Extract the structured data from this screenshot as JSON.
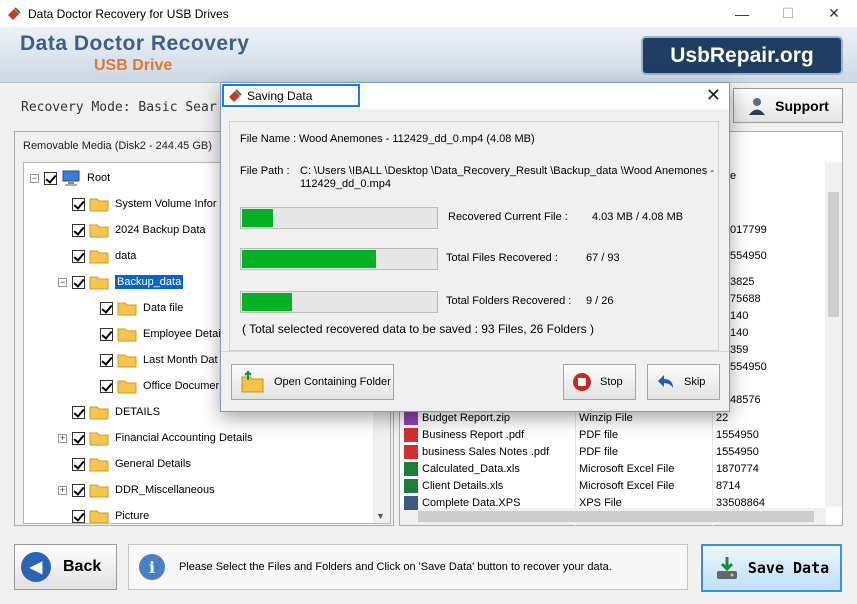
{
  "window": {
    "title": "Data Doctor Recovery for USB Drives",
    "controls": {
      "minimize": "—",
      "maximize": "☐",
      "close": "✕"
    }
  },
  "banner": {
    "brand": "Data Doctor Recovery",
    "subtitle": "USB Drive",
    "site": "UsbRepair.org"
  },
  "mode": {
    "text": "Recovery Mode: Basic Sear"
  },
  "support": {
    "label": "Support"
  },
  "left_panel": {
    "media_label": "Removable Media (Disk2 - 244.45 GB)",
    "tree": [
      {
        "label": "Root",
        "level": 0,
        "expander": "−",
        "icon": "computer"
      },
      {
        "label": "System Volume Infor",
        "level": 1,
        "expander": "",
        "icon": "folder"
      },
      {
        "label": "2024 Backup Data",
        "level": 1,
        "expander": "",
        "icon": "folder"
      },
      {
        "label": "data",
        "level": 1,
        "expander": "",
        "icon": "folder"
      },
      {
        "label": "Backup_data",
        "level": 1,
        "expander": "−",
        "icon": "folder",
        "selected": true
      },
      {
        "label": "Data file",
        "level": 2,
        "expander": "",
        "icon": "folder"
      },
      {
        "label": "Employee Detai",
        "level": 2,
        "expander": "",
        "icon": "folder"
      },
      {
        "label": "Last Month Dat",
        "level": 2,
        "expander": "",
        "icon": "folder"
      },
      {
        "label": "Office Documer",
        "level": 2,
        "expander": "",
        "icon": "folder"
      },
      {
        "label": "DETAILS",
        "level": 1,
        "expander": "",
        "icon": "folder"
      },
      {
        "label": "Financial Accounting Details",
        "level": 1,
        "expander": "+",
        "icon": "folder"
      },
      {
        "label": "General Details",
        "level": 1,
        "expander": "",
        "icon": "folder"
      },
      {
        "label": "DDR_Miscellaneous",
        "level": 1,
        "expander": "+",
        "icon": "folder"
      },
      {
        "label": "Picture",
        "level": 1,
        "expander": "",
        "icon": "folder"
      }
    ]
  },
  "right_panel": {
    "partial_values": [
      "e",
      "017799",
      "554950",
      "3825",
      "75688",
      "140",
      "140",
      "359",
      "554950",
      "48576"
    ],
    "files": [
      {
        "name": "Budget Report.zip",
        "type": "Winzip File",
        "size": "22",
        "icon": "zip"
      },
      {
        "name": "Business Report .pdf",
        "type": "PDF file",
        "size": "1554950",
        "icon": "pdf"
      },
      {
        "name": "business Sales Notes .pdf",
        "type": "PDF file",
        "size": "1554950",
        "icon": "pdf"
      },
      {
        "name": "Calculated_Data.xls",
        "type": "Microsoft Excel File",
        "size": "1870774",
        "icon": "xls"
      },
      {
        "name": "Client Details.xls",
        "type": "Microsoft Excel File",
        "size": "8714",
        "icon": "xls"
      },
      {
        "name": "Complete Data.XPS",
        "type": "XPS File",
        "size": "33508864",
        "icon": "xps"
      }
    ]
  },
  "dialog": {
    "title": "Saving Data",
    "file_name_label": "File Name :",
    "file_name_value": "Wood Anemones - 112429_dd_0.mp4 (4.08 MB)",
    "file_path_label": "File Path  :",
    "file_path_line1": "C: \\Users \\IBALL \\Desktop \\Data_Recovery_Result \\Backup_data \\Wood Anemones -",
    "file_path_line2": "112429_dd_0.mp4",
    "progress": [
      {
        "label": "Recovered Current File :",
        "value": "4.03 MB /   4.08 MB",
        "fraction": 0.16
      },
      {
        "label": "Total Files Recovered :",
        "value": "67 / 93",
        "fraction": 0.69
      },
      {
        "label": "Total Folders Recovered :",
        "value": "9 / 26",
        "fraction": 0.26
      }
    ],
    "summary": "( Total selected recovered data to be saved : 93 Files, 26 Folders )",
    "buttons": {
      "open_folder": "Open Containing Folder",
      "stop": "Stop",
      "skip": "Skip"
    }
  },
  "bottom": {
    "back": "Back",
    "info": "Please Select the Files and Folders and Click on 'Save Data' button to recover your data.",
    "save": "Save Data"
  }
}
